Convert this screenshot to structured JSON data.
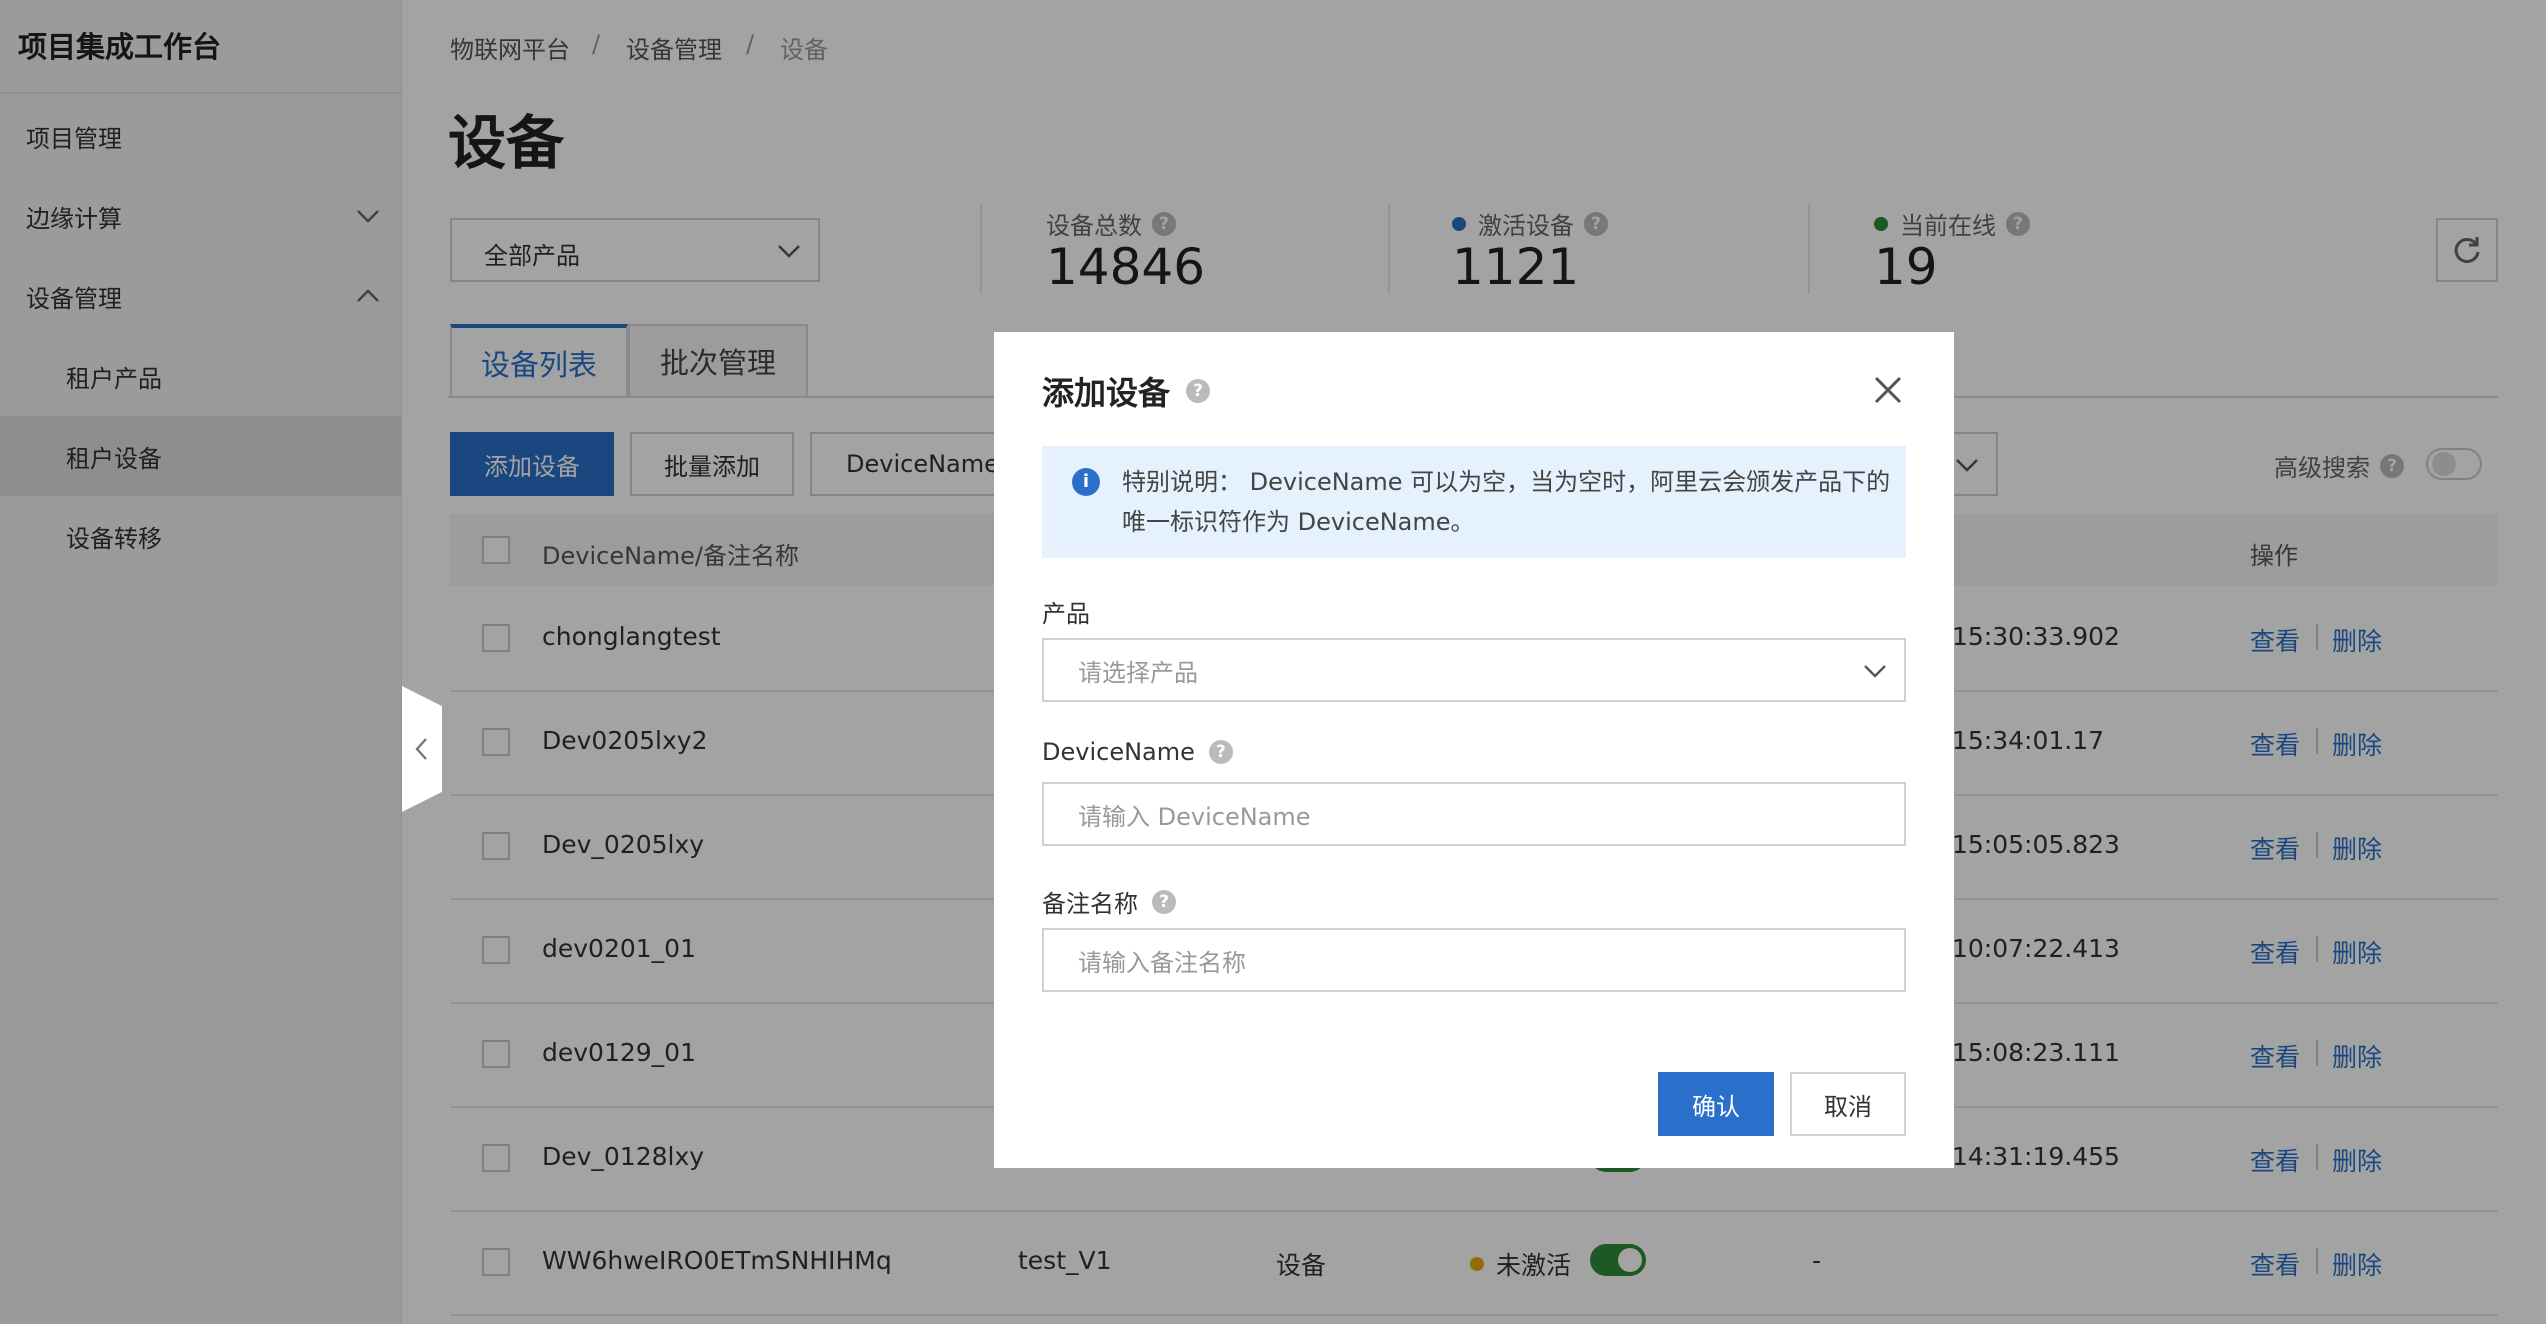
{
  "sidebar": {
    "title": "项目集成工作台",
    "items": [
      {
        "label": "项目管理"
      },
      {
        "label": "边缘计算"
      },
      {
        "label": "设备管理"
      },
      {
        "label": "租户产品"
      },
      {
        "label": "租户设备"
      },
      {
        "label": "设备转移"
      }
    ]
  },
  "breadcrumb": [
    "物联网平台",
    "设备管理",
    "设备"
  ],
  "page_title": "设备",
  "product_filter": "全部产品",
  "stats": {
    "total_label": "设备总数",
    "total_value": "14846",
    "active_label": "激活设备",
    "active_value": "1121",
    "online_label": "当前在线",
    "online_value": "19"
  },
  "tabs": [
    "设备列表",
    "批次管理"
  ],
  "toolbar": {
    "add": "添加设备",
    "batch_add": "批量添加",
    "search_field": "DeviceName",
    "advanced": "高级搜索"
  },
  "table": {
    "headers": [
      "DeviceName/备注名称",
      "操作"
    ],
    "rows": [
      {
        "name": "chonglangtest",
        "time": "15:30:33.902"
      },
      {
        "name": "Dev0205lxy2",
        "time": "15:34:01.17"
      },
      {
        "name": "Dev_0205lxy",
        "time": "15:05:05.823"
      },
      {
        "name": "dev0201_01",
        "time": "10:07:22.413"
      },
      {
        "name": "dev0129_01",
        "time": "15:08:23.111"
      },
      {
        "name": "Dev_0128lxy",
        "time": "14:31:19.455"
      },
      {
        "name": "WW6hweIRO0ETmSNHIHMq",
        "product": "test_V1",
        "type": "设备",
        "status": "未激活",
        "time": "-"
      }
    ],
    "view": "查看",
    "delete": "删除"
  },
  "modal": {
    "title": "添加设备",
    "notice": "特别说明： DeviceName 可以为空，当为空时，阿里云会颁发产品下的唯一标识符作为 DeviceName。",
    "product_label": "产品",
    "product_placeholder": "请选择产品",
    "devicename_label": "DeviceName",
    "devicename_placeholder": "请输入 DeviceName",
    "remark_label": "备注名称",
    "remark_placeholder": "请输入备注名称",
    "confirm": "确认",
    "cancel": "取消"
  },
  "colors": {
    "primary": "#2a6fc9",
    "active_dot": "#2a6fc9",
    "online_dot": "#2e8b3a",
    "inactive_dot": "#e6a817"
  }
}
